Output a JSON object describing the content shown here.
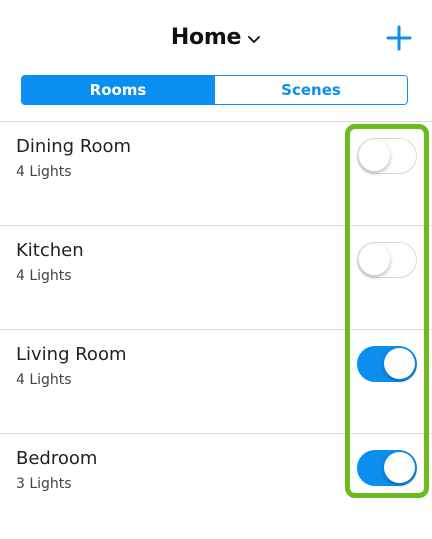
{
  "header": {
    "title": "Home",
    "title_menu_icon": "chevron-down-icon",
    "add_icon": "plus-icon"
  },
  "tabs": [
    {
      "label": "Rooms",
      "active": true
    },
    {
      "label": "Scenes",
      "active": false
    }
  ],
  "rooms": [
    {
      "name": "Dining Room",
      "subtitle": "4 Lights",
      "on": false
    },
    {
      "name": "Kitchen",
      "subtitle": "4 Lights",
      "on": false
    },
    {
      "name": "Living Room",
      "subtitle": "4 Lights",
      "on": true
    },
    {
      "name": "Bedroom",
      "subtitle": "3 Lights",
      "on": true
    }
  ],
  "colors": {
    "accent": "#0a8ef0",
    "highlight": "#6cbb1c",
    "divider": "#dcdcdc",
    "toggle_off_border": "#d8d8d8"
  }
}
